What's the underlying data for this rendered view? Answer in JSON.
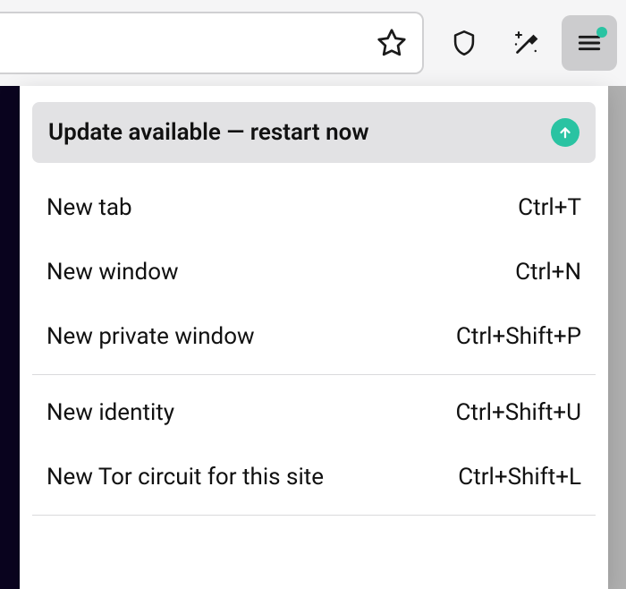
{
  "toolbar": {
    "star_icon": "star-icon",
    "shield_icon": "shield-icon",
    "broom_icon": "sparkle-broom-icon",
    "menu_icon": "hamburger-icon",
    "menu_has_notification": true
  },
  "menu": {
    "update": {
      "label": "Update available — restart now",
      "icon": "up-arrow-icon"
    },
    "groups": [
      [
        {
          "id": "new-tab",
          "label": "New tab",
          "shortcut": "Ctrl+T"
        },
        {
          "id": "new-window",
          "label": "New window",
          "shortcut": "Ctrl+N"
        },
        {
          "id": "new-private-window",
          "label": "New private window",
          "shortcut": "Ctrl+Shift+P"
        }
      ],
      [
        {
          "id": "new-identity",
          "label": "New identity",
          "shortcut": "Ctrl+Shift+U"
        },
        {
          "id": "new-tor-circuit",
          "label": "New Tor circuit for this site",
          "shortcut": "Ctrl+Shift+L"
        }
      ]
    ]
  },
  "colors": {
    "accent_green": "#2ac3a2",
    "banner_bg": "#e2e2e4"
  }
}
